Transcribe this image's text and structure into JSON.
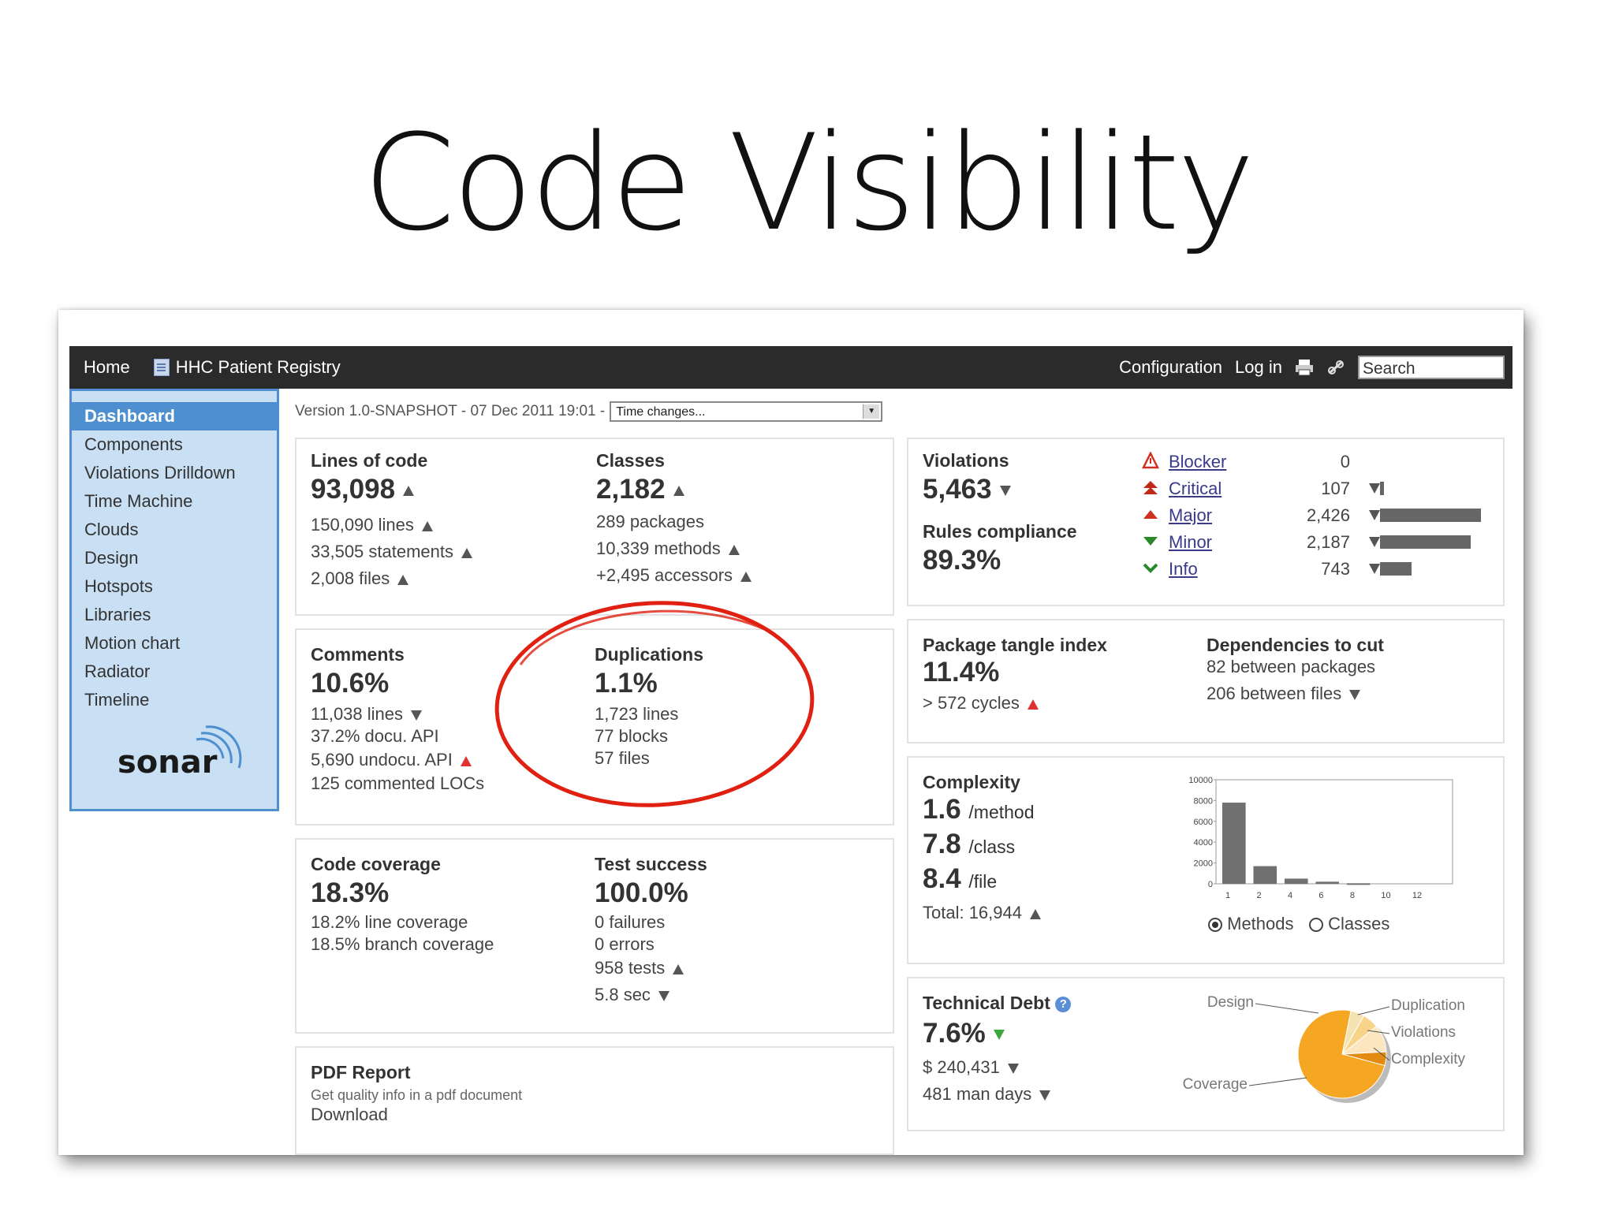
{
  "slide": {
    "title": "Code Visibility"
  },
  "nav": {
    "home": "Home",
    "project": "HHC Patient Registry",
    "configuration": "Configuration",
    "login": "Log in",
    "search_placeholder": "Search"
  },
  "sidebar": {
    "items": [
      "Dashboard",
      "Components",
      "Violations Drilldown",
      "Time Machine",
      "Clouds",
      "Design",
      "Hotspots",
      "Libraries",
      "Motion chart",
      "Radiator",
      "Timeline"
    ],
    "logo": "sonar"
  },
  "version": {
    "text": "Version 1.0-SNAPSHOT - 07 Dec 2011 19:01 -",
    "select_value": "Time changes..."
  },
  "size": {
    "loc_label": "Lines of code",
    "loc_value": "93,098",
    "lines": "150,090 lines",
    "statements": "33,505 statements",
    "files": "2,008 files",
    "classes_label": "Classes",
    "classes_value": "2,182",
    "packages": "289 packages",
    "methods": "10,339 methods",
    "accessors": "+2,495 accessors"
  },
  "comments": {
    "label": "Comments",
    "value": "10.6%",
    "lines": "11,038 lines",
    "docu_api": "37.2% docu. API",
    "undocu_api": "5,690 undocu. API",
    "commented_locs": "125 commented LOCs"
  },
  "duplications": {
    "label": "Duplications",
    "value": "1.1%",
    "lines": "1,723 lines",
    "blocks": "77 blocks",
    "files": "57 files"
  },
  "coverage": {
    "label": "Code coverage",
    "value": "18.3%",
    "line_coverage": "18.2% line coverage",
    "branch_coverage": "18.5% branch coverage"
  },
  "tests": {
    "label": "Test success",
    "value": "100.0%",
    "failures": "0 failures",
    "errors": "0 errors",
    "tests": "958 tests",
    "time": "5.8 sec"
  },
  "pdf": {
    "label": "PDF Report",
    "desc": "Get quality info in a pdf document",
    "download": "Download"
  },
  "violations": {
    "label": "Violations",
    "value": "5,463",
    "compliance_label": "Rules compliance",
    "compliance_value": "89.3%",
    "severities": [
      {
        "name": "Blocker",
        "count": "0",
        "fraction": 0.0
      },
      {
        "name": "Critical",
        "count": "107",
        "fraction": 0.04
      },
      {
        "name": "Major",
        "count": "2,426",
        "fraction": 1.0
      },
      {
        "name": "Minor",
        "count": "2,187",
        "fraction": 0.9
      },
      {
        "name": "Info",
        "count": "743",
        "fraction": 0.31
      }
    ]
  },
  "design": {
    "tangle_label": "Package tangle index",
    "tangle_value": "11.4%",
    "cycles": "> 572 cycles",
    "deps_label": "Dependencies to cut",
    "deps_packages": "82 between packages",
    "deps_files": "206 between files"
  },
  "complexity": {
    "label": "Complexity",
    "method_value": "1.6",
    "method_unit": "/method",
    "class_value": "7.8",
    "class_unit": "/class",
    "file_value": "8.4",
    "file_unit": "/file",
    "total": "Total: 16,944",
    "radio_methods": "Methods",
    "radio_classes": "Classes"
  },
  "chart_data": {
    "type": "bar",
    "categories": [
      "1",
      "2",
      "4",
      "6",
      "8",
      "10",
      "12"
    ],
    "values": [
      7800,
      1700,
      500,
      200,
      50,
      0,
      0
    ],
    "ylim": [
      0,
      10000
    ],
    "yticks": [
      "10000",
      "8000",
      "6000",
      "4000",
      "2000",
      "0"
    ],
    "bar_color": "#707070"
  },
  "debt": {
    "label": "Technical Debt",
    "value": "7.6%",
    "cost": "$ 240,431",
    "days": "481 man days",
    "pie": [
      {
        "name": "Design",
        "fraction": 0.05,
        "color": "#f4e2b0"
      },
      {
        "name": "Duplication",
        "fraction": 0.06,
        "color": "#f7d48a"
      },
      {
        "name": "Violations",
        "fraction": 0.1,
        "color": "#fbe6c0"
      },
      {
        "name": "Complexity",
        "fraction": 0.05,
        "color": "#e38b10"
      },
      {
        "name": "Coverage",
        "fraction": 0.74,
        "color": "#f5a623"
      }
    ]
  },
  "colors": {
    "topbar": "#2b2b2b",
    "sidebar": "#c9dff3",
    "accent": "#4e8fd0",
    "annotation": "#e02010"
  }
}
